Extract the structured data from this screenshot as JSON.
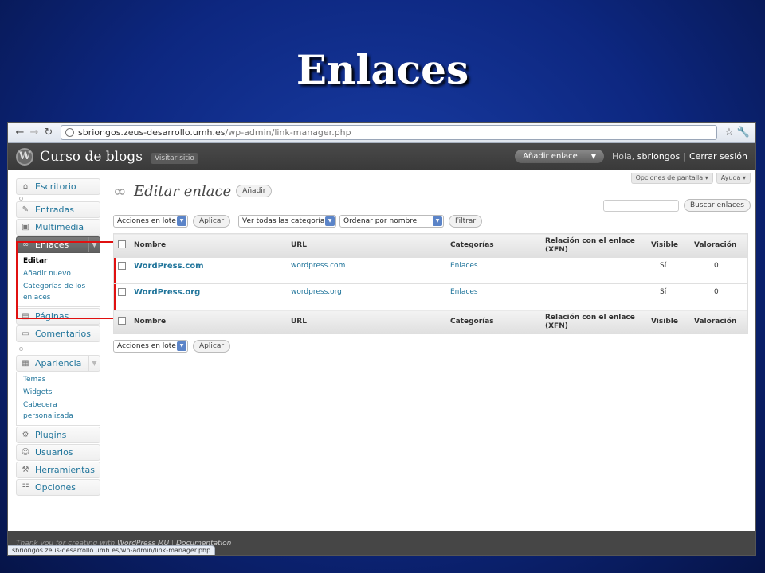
{
  "slide": {
    "title": "Enlaces"
  },
  "browser": {
    "url_host": "sbriongos.zeus-desarrollo.umh.es",
    "url_path": "/wp-admin/link-manager.php",
    "status_url": "sbriongos.zeus-desarrollo.umh.es/wp-admin/link-manager.php"
  },
  "header": {
    "site_name": "Curso de blogs",
    "visit_site": "Visitar sitio",
    "add_link": "Añadir enlace",
    "greeting": "Hola,",
    "user": "sbriongos",
    "logout": "Cerrar sesión"
  },
  "top_tabs": {
    "screen_options": "Opciones de pantalla ▾",
    "help": "Ayuda ▾"
  },
  "sidebar": {
    "escritorio": "Escritorio",
    "entradas": "Entradas",
    "multimedia": "Multimedia",
    "enlaces": "Enlaces",
    "enlaces_sub": [
      "Editar",
      "Añadir nuevo",
      "Categorías de los enlaces"
    ],
    "paginas": "Páginas",
    "comentarios": "Comentarios",
    "apariencia": "Apariencia",
    "apariencia_sub": [
      "Temas",
      "Widgets",
      "Cabecera personalizada"
    ],
    "plugins": "Plugins",
    "usuarios": "Usuarios",
    "herramientas": "Herramientas",
    "opciones": "Opciones"
  },
  "main": {
    "title": "Editar enlace",
    "add_button": "Añadir",
    "search_button": "Buscar enlaces",
    "bulk_actions": "Acciones en lote",
    "apply": "Aplicar",
    "categories_filter": "Ver todas las categorías",
    "order_filter": "Ordenar por nombre",
    "filter_button": "Filtrar",
    "columns": {
      "name": "Nombre",
      "url": "URL",
      "categories": "Categorías",
      "rel": "Relación con el enlace (XFN)",
      "visible": "Visible",
      "rating": "Valoración"
    },
    "rows": [
      {
        "name": "WordPress.com",
        "url": "wordpress.com",
        "category": "Enlaces",
        "rel": "",
        "visible": "Sí",
        "rating": "0"
      },
      {
        "name": "WordPress.org",
        "url": "wordpress.org",
        "category": "Enlaces",
        "rel": "",
        "visible": "Sí",
        "rating": "0"
      }
    ]
  },
  "footer": {
    "thanks": "Thank you for creating with",
    "wpmu": "WordPress MU",
    "sep": "|",
    "docs": "Documentation"
  }
}
